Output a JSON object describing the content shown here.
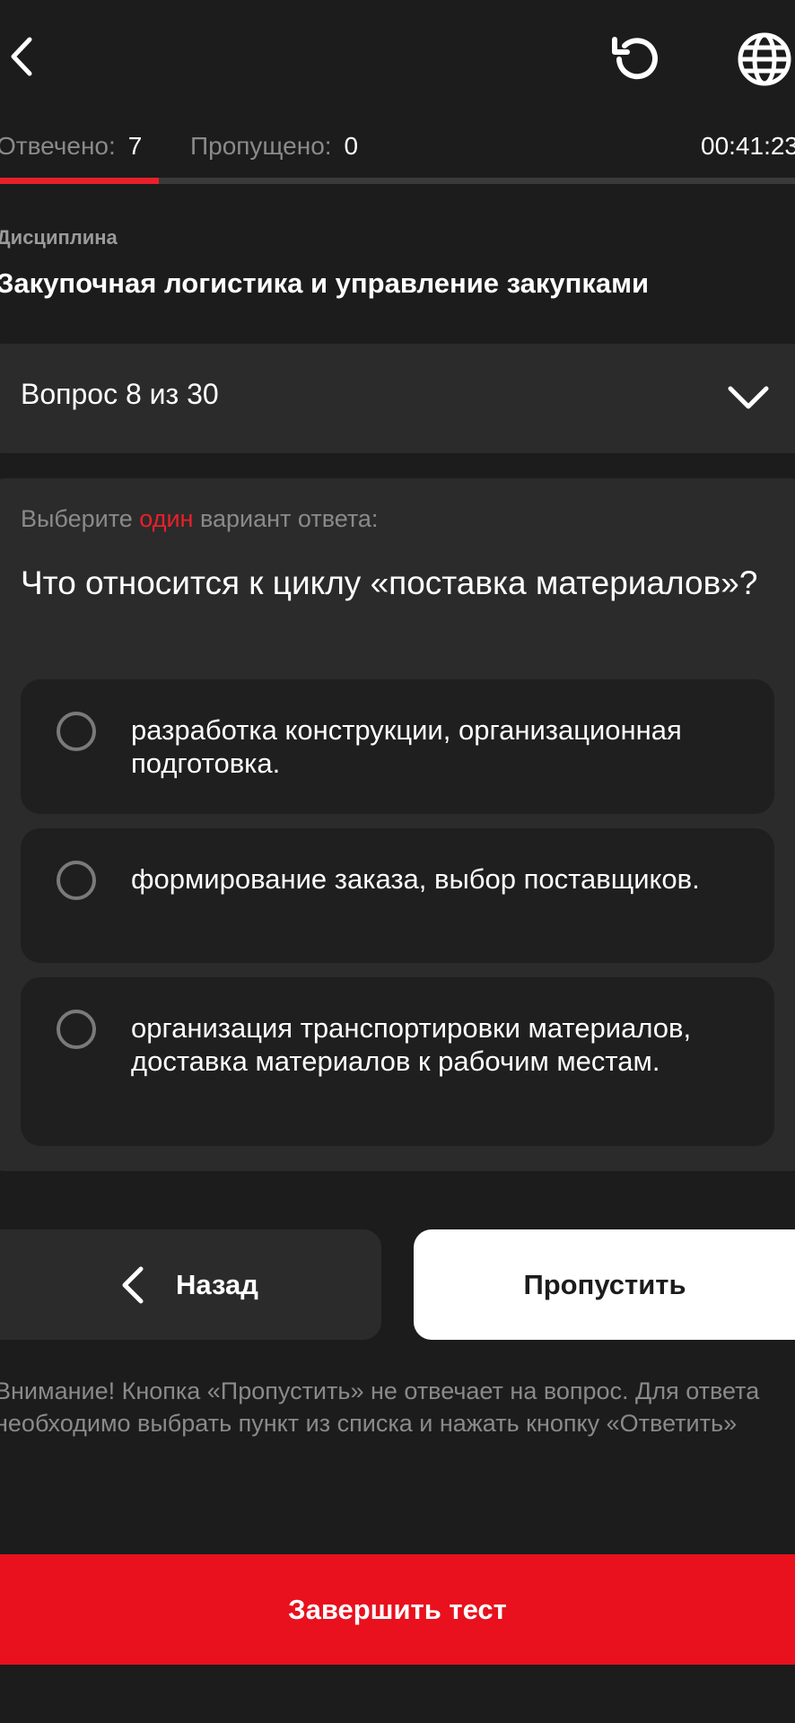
{
  "header": {
    "back_icon": "chevron-left-icon",
    "reset_icon": "refresh-icon",
    "language_icon": "globe-icon"
  },
  "stats": {
    "answered_label": "Отвечено:",
    "answered_value": "7",
    "skipped_label": "Пропущено:",
    "skipped_value": "0",
    "timer": "00:41:23"
  },
  "progress": {
    "fraction": 0.2
  },
  "discipline": {
    "label": "Дисциплина",
    "title": "Закупочная логистика и управление закупками"
  },
  "question_selector": {
    "label": "Вопрос 8 из 30",
    "icon": "chevron-down-icon"
  },
  "question": {
    "instruction_before": "Выберите ",
    "instruction_accent": "один",
    "instruction_after": " вариант ответа:",
    "text": "Что относится к циклу «поставка материалов»?",
    "options": [
      {
        "text": "разработка конструкции, организационная подготовка."
      },
      {
        "text": "формирование заказа, выбор поставщиков."
      },
      {
        "text": "организация транспортировки материалов, доставка материалов к рабочим местам."
      }
    ]
  },
  "actions": {
    "back_label": "Назад",
    "skip_label": "Пропустить",
    "finish_label": "Завершить тест"
  },
  "notice": "Внимание! Кнопка «Пропустить» не отвечает на вопрос. Для ответа необходимо выбрать пункт из списка и нажать кнопку «Ответить»",
  "colors": {
    "background": "#1c1c1c",
    "card": "#2b2b2b",
    "option_bg": "#1f1f1f",
    "accent": "#e8202a",
    "finish_button": "#e8111d",
    "muted_text": "#8a8a8a"
  }
}
